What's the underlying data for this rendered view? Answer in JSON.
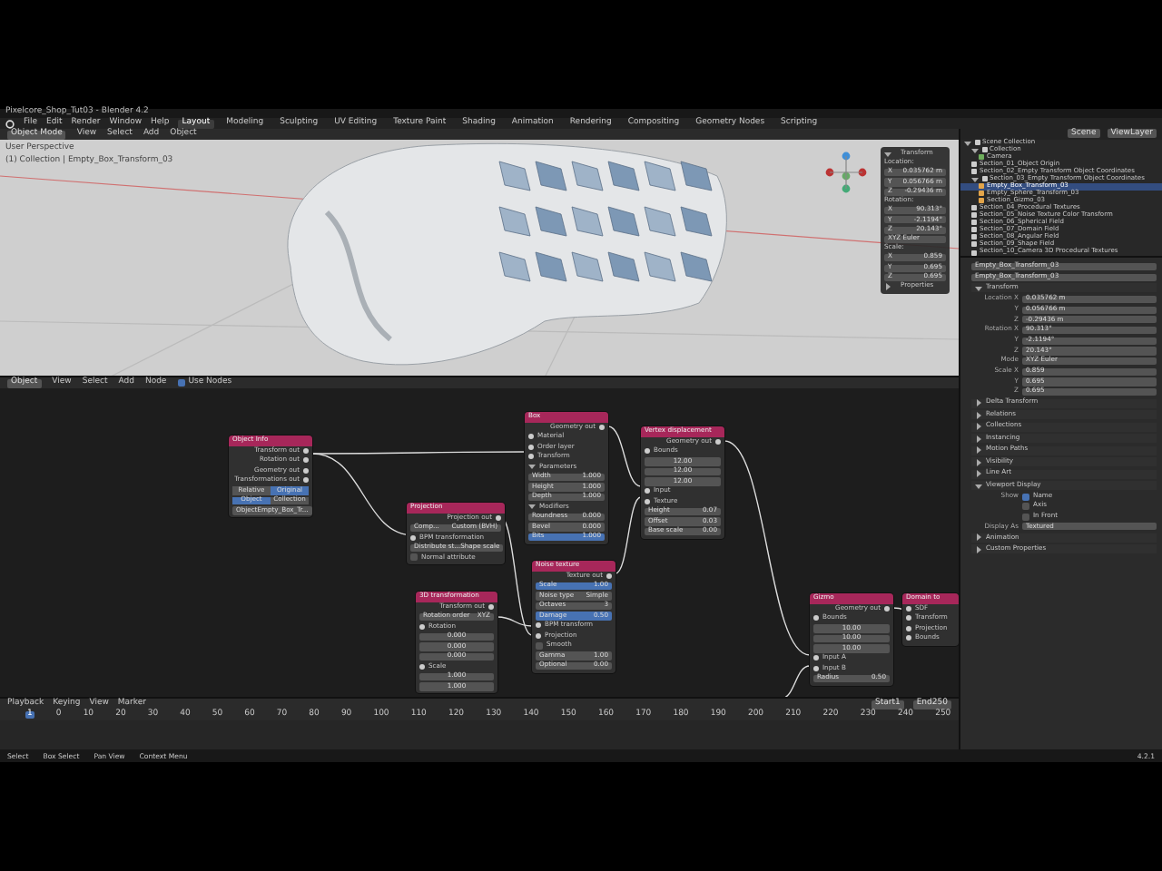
{
  "window": {
    "title": "Pixelcore_Shop_Tut03 - Blender 4.2"
  },
  "menu": [
    "File",
    "Edit",
    "Render",
    "Window",
    "Help"
  ],
  "workspaces": [
    {
      "label": "Layout",
      "selected": true
    },
    {
      "label": "Modeling",
      "selected": false
    },
    {
      "label": "Sculpting",
      "selected": false
    },
    {
      "label": "UV Editing",
      "selected": false
    },
    {
      "label": "Texture Paint",
      "selected": false
    },
    {
      "label": "Shading",
      "selected": false
    },
    {
      "label": "Animation",
      "selected": false
    },
    {
      "label": "Rendering",
      "selected": false
    },
    {
      "label": "Compositing",
      "selected": false
    },
    {
      "label": "Geometry Nodes",
      "selected": false
    },
    {
      "label": "Scripting",
      "selected": false
    }
  ],
  "viewport": {
    "mode": "Object Mode",
    "menu": [
      "View",
      "Select",
      "Add",
      "Object"
    ],
    "overlay_text": [
      "User Perspective",
      "(1) Collection | Empty_Box_Transform_03"
    ],
    "n_panel": {
      "title": "Transform",
      "location_label": "Location:",
      "location": [
        {
          "axis": "X",
          "value": "0.035762 m"
        },
        {
          "axis": "Y",
          "value": "0.056766 m"
        },
        {
          "axis": "Z",
          "value": "-0.29436 m"
        }
      ],
      "rotation_label": "Rotation:",
      "rotation": [
        {
          "axis": "X",
          "value": "90.313°"
        },
        {
          "axis": "Y",
          "value": "-2.1194°"
        },
        {
          "axis": "Z",
          "value": "20.143°"
        }
      ],
      "mode": "XYZ Euler",
      "scale_label": "Scale:",
      "scale": [
        {
          "axis": "X",
          "value": "0.859"
        },
        {
          "axis": "Y",
          "value": "0.695"
        },
        {
          "axis": "Z",
          "value": "0.695"
        }
      ],
      "footer": "Properties"
    }
  },
  "node_editor": {
    "editor": "Object",
    "menu": [
      "View",
      "Select",
      "Add",
      "Node"
    ],
    "use_nodes": {
      "label": "Use Nodes",
      "checked": true
    },
    "nodes": [
      {
        "title": "Object Info",
        "rows": [
          {
            "kind": "out",
            "label": "Transform out"
          },
          {
            "kind": "out",
            "label": "Rotation out"
          },
          {
            "kind": "out",
            "label": "Geometry out"
          },
          {
            "kind": "out",
            "label": "Transformations out"
          },
          {
            "kind": "toggle",
            "options": [
              {
                "label": "Relative",
                "selected": false
              },
              {
                "label": "Original",
                "selected": true
              }
            ]
          },
          {
            "kind": "toggle",
            "options": [
              {
                "label": "Object",
                "selected": true
              },
              {
                "label": "Collection",
                "selected": false
              }
            ]
          },
          {
            "kind": "field",
            "label": "Object",
            "value": "Empty_Box_Tr..."
          }
        ]
      },
      {
        "title": "Box",
        "rows": [
          {
            "kind": "out",
            "label": "Geometry out"
          },
          {
            "kind": "in",
            "label": "Material"
          },
          {
            "kind": "in",
            "label": "Order layer"
          },
          {
            "kind": "in",
            "label": "Transform"
          },
          {
            "kind": "section",
            "label": "Parameters"
          },
          {
            "kind": "field",
            "label": "Width",
            "value": "1.000"
          },
          {
            "kind": "field",
            "label": "Height",
            "value": "1.000"
          },
          {
            "kind": "field",
            "label": "Depth",
            "value": "1.000"
          },
          {
            "kind": "section",
            "label": "Modifiers"
          },
          {
            "kind": "field",
            "label": "Roundness",
            "value": "0.000"
          },
          {
            "kind": "field",
            "label": "Bevel",
            "value": "0.000"
          },
          {
            "kind": "field",
            "label": "Bits",
            "value": "1.000",
            "selected": true
          }
        ]
      },
      {
        "title": "Vertex displacement",
        "rows": [
          {
            "kind": "out",
            "label": "Geometry out"
          },
          {
            "kind": "in",
            "label": "Bounds"
          },
          {
            "kind": "vector",
            "values": [
              "12.00",
              "12.00",
              "12.00"
            ]
          },
          {
            "kind": "in",
            "label": "Input"
          },
          {
            "kind": "in",
            "label": "Texture"
          },
          {
            "kind": "field",
            "label": "Height",
            "value": "0.07"
          },
          {
            "kind": "field",
            "label": "Offset",
            "value": "0.03"
          },
          {
            "kind": "field",
            "label": "Base scale",
            "value": "0.00"
          }
        ]
      },
      {
        "title": "Projection",
        "rows": [
          {
            "kind": "out",
            "label": "Projection out"
          },
          {
            "kind": "field",
            "label": "Comp...",
            "value": "Custom (BVH)"
          },
          {
            "kind": "in",
            "label": "BPM transformation"
          },
          {
            "kind": "field",
            "label": "Distribute st...",
            "value": "Shape scale"
          },
          {
            "kind": "check",
            "label": "Normal attribute",
            "checked": false
          }
        ]
      },
      {
        "title": "Noise texture",
        "rows": [
          {
            "kind": "out",
            "label": "Texture out"
          },
          {
            "kind": "field",
            "label": "Scale",
            "value": "1.00",
            "selected": true
          },
          {
            "kind": "field",
            "label": "Noise type",
            "value": "Simple"
          },
          {
            "kind": "field",
            "label": "Octaves",
            "value": "3"
          },
          {
            "kind": "field",
            "label": "Damage",
            "value": "0.50",
            "selected": true
          },
          {
            "kind": "in",
            "label": "BPM transform"
          },
          {
            "kind": "in",
            "label": "Projection"
          },
          {
            "kind": "check",
            "label": "Smooth",
            "checked": false
          },
          {
            "kind": "field",
            "label": "Gamma",
            "value": "1.00"
          },
          {
            "kind": "field",
            "label": "Optional",
            "value": "0.00"
          }
        ]
      },
      {
        "title": "3D transformation",
        "rows": [
          {
            "kind": "out",
            "label": "Transform out"
          },
          {
            "kind": "field",
            "label": "Rotation order",
            "value": "XYZ"
          },
          {
            "kind": "in",
            "label": "Rotation"
          },
          {
            "kind": "vector",
            "values": [
              "0.000",
              "0.000",
              "0.000"
            ]
          },
          {
            "kind": "in",
            "label": "Scale"
          },
          {
            "kind": "vector",
            "values": [
              "1.000",
              "1.000"
            ]
          }
        ]
      },
      {
        "title": "Gizmo",
        "rows": [
          {
            "kind": "out",
            "label": "Geometry out"
          },
          {
            "kind": "in",
            "label": "Bounds"
          },
          {
            "kind": "vector",
            "values": [
              "10.00",
              "10.00",
              "10.00"
            ]
          },
          {
            "kind": "in",
            "label": "Input A"
          },
          {
            "kind": "in",
            "label": "Input B"
          },
          {
            "kind": "field",
            "label": "Radius",
            "value": "0.50"
          }
        ]
      },
      {
        "title": "Domain to",
        "rows": [
          {
            "kind": "in",
            "label": "SDF"
          },
          {
            "kind": "in",
            "label": "Transform"
          },
          {
            "kind": "in",
            "label": "Projection"
          },
          {
            "kind": "in",
            "label": "Bounds"
          }
        ]
      }
    ]
  },
  "timeline": {
    "menu": [
      "Playback",
      "Keying",
      "View",
      "Marker"
    ],
    "current_frame": "1",
    "frames": [
      "0",
      "10",
      "20",
      "30",
      "40",
      "50",
      "60",
      "70",
      "80",
      "90",
      "100",
      "110",
      "120",
      "130",
      "140",
      "150",
      "160",
      "170",
      "180",
      "190",
      "200",
      "210",
      "220",
      "230",
      "240",
      "250"
    ],
    "start_label": "Start",
    "start": "1",
    "end_label": "End",
    "end": "250"
  },
  "outliner": {
    "scene": "Scene",
    "view_layer": "ViewLayer",
    "items": [
      {
        "label": "Scene Collection",
        "kind": "collection",
        "selected": false,
        "children": [
          {
            "label": "Collection",
            "kind": "collection",
            "selected": false,
            "children": [
              {
                "label": "Camera",
                "kind": "camera",
                "selected": false
              }
            ]
          },
          {
            "label": "Section_01_Object Origin",
            "kind": "collection",
            "selected": false
          },
          {
            "label": "Section_02_Empty Transform Object Coordinates",
            "kind": "collection",
            "selected": false
          },
          {
            "label": "Section_03_Empty Transform Object Coordinates",
            "kind": "collection",
            "selected": false,
            "children": [
              {
                "label": "Empty_Box_Transform_03",
                "kind": "object",
                "selected": true
              },
              {
                "label": "Empty_Sphere_Transform_03",
                "kind": "object",
                "selected": false
              },
              {
                "label": "Section_Gizmo_03",
                "kind": "object",
                "selected": false
              }
            ]
          },
          {
            "label": "Section_04_Procedural Textures",
            "kind": "collection",
            "selected": false
          },
          {
            "label": "Section_05_Noise Texture Color Transform",
            "kind": "collection",
            "selected": false
          },
          {
            "label": "Section_06_Spherical Field",
            "kind": "collection",
            "selected": false
          },
          {
            "label": "Section_07_Domain Field",
            "kind": "collection",
            "selected": false
          },
          {
            "label": "Section_08_Angular Field",
            "kind": "collection",
            "selected": false
          },
          {
            "label": "Section_09_Shape Field",
            "kind": "collection",
            "selected": false
          },
          {
            "label": "Section_10_Camera 3D Procedural Textures",
            "kind": "collection",
            "selected": false
          }
        ]
      }
    ]
  },
  "properties": {
    "object_name": "Empty_Box_Transform_03",
    "data_name": "Empty_Box_Transform_03",
    "transform": {
      "title": "Transform",
      "location": [
        {
          "label": "Location X",
          "value": "0.035762 m"
        },
        {
          "label": "Y",
          "value": "0.056766 m"
        },
        {
          "label": "Z",
          "value": "-0.29436 m"
        }
      ],
      "rotation": [
        {
          "label": "Rotation X",
          "value": "90.313°"
        },
        {
          "label": "Y",
          "value": "-2.1194°"
        },
        {
          "label": "Z",
          "value": "20.143°"
        }
      ],
      "mode_label": "Mode",
      "mode": "XYZ Euler",
      "scale": [
        {
          "label": "Scale X",
          "value": "0.859"
        },
        {
          "label": "Y",
          "value": "0.695"
        },
        {
          "label": "Z",
          "value": "0.695"
        }
      ]
    },
    "panels": [
      {
        "label": "Delta Transform",
        "expanded": false
      },
      {
        "label": "Relations",
        "expanded": false
      },
      {
        "label": "Collections",
        "expanded": false
      },
      {
        "label": "Instancing",
        "expanded": false
      },
      {
        "label": "Motion Paths",
        "expanded": false
      },
      {
        "label": "Visibility",
        "expanded": false
      },
      {
        "label": "Line Art",
        "expanded": false
      },
      {
        "label": "Viewport Display",
        "expanded": true,
        "show_label": "Show",
        "options": [
          {
            "label": "Name",
            "checked": true
          },
          {
            "label": "Axis",
            "checked": false
          },
          {
            "label": "In Front",
            "checked": false
          }
        ],
        "display_as_label": "Display As",
        "display_as": "Textured"
      },
      {
        "label": "Animation",
        "expanded": false
      },
      {
        "label": "Custom Properties",
        "expanded": false
      }
    ]
  },
  "status_bar": {
    "hints": [
      "Select",
      "Box Select",
      "Pan View",
      "Context Menu"
    ],
    "version": "4.2.1"
  }
}
